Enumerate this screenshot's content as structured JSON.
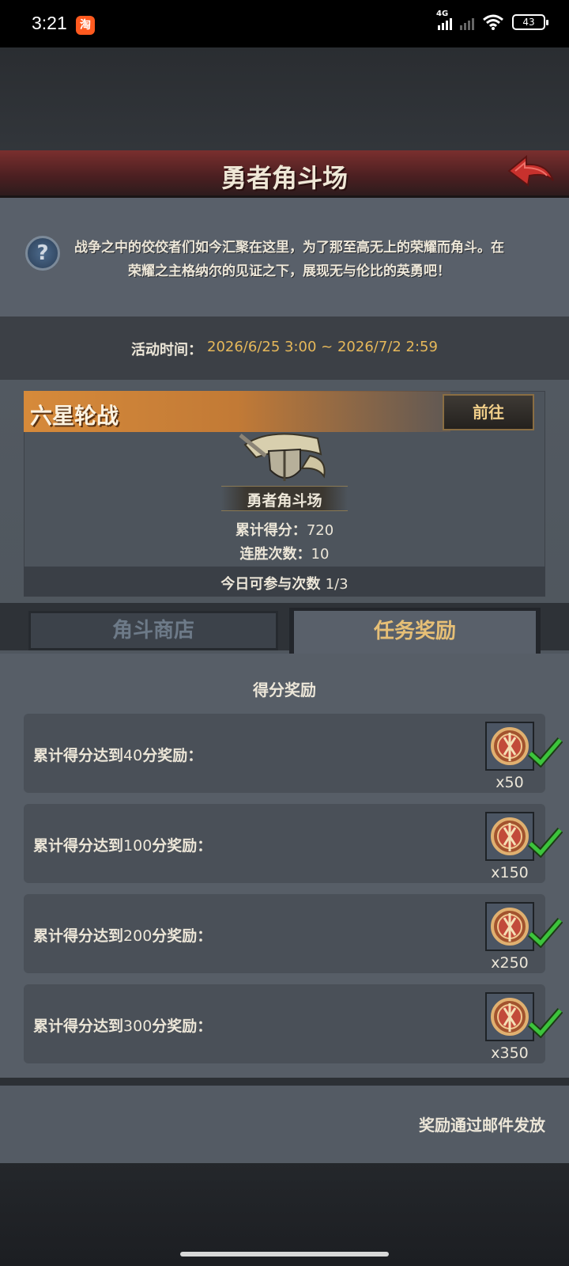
{
  "status_bar": {
    "time": "3:21",
    "app_icon_text": "淘",
    "network": "4G",
    "battery": "43"
  },
  "header": {
    "title": "勇者角斗场",
    "back_icon": "red-back-arrow-icon"
  },
  "intro": {
    "help_icon": "?",
    "text": "战争之中的佼佼者们如今汇聚在这里，为了那至高无上的荣耀而角斗。在荣耀之主格纳尔的见证之下，展现无与伦比的英勇吧！"
  },
  "event_time": {
    "label": "活动时间：",
    "value": "2026/6/25 3:00 ~ 2026/7/2 2:59"
  },
  "event": {
    "name": "六星轮战",
    "go_button": "前往",
    "arena_name": "勇者角斗场",
    "score_label": "累计得分：",
    "score_value": "720",
    "streak_label": "连胜次数：",
    "streak_value": "10",
    "daily_label": "今日可参与次数",
    "daily_value": "1/3"
  },
  "tabs": {
    "shop": "角斗商店",
    "tasks": "任务奖励"
  },
  "tasks": {
    "section_title": "得分奖励",
    "rewards": [
      {
        "prefix": "累计得分达到",
        "score": "40",
        "suffix": "分奖励：",
        "qty": "x50",
        "claimed": true
      },
      {
        "prefix": "累计得分达到",
        "score": "100",
        "suffix": "分奖励：",
        "qty": "x150",
        "claimed": true
      },
      {
        "prefix": "累计得分达到",
        "score": "200",
        "suffix": "分奖励：",
        "qty": "x250",
        "claimed": true
      },
      {
        "prefix": "累计得分达到",
        "score": "300",
        "suffix": "分奖励：",
        "qty": "x350",
        "claimed": true
      }
    ]
  },
  "footer": {
    "note": "奖励通过邮件发放"
  },
  "colors": {
    "accent_gold": "#e6b85a",
    "tab_active": "#e6bf76",
    "check_green": "#3cc43c",
    "banner_red": "#7a2f2e"
  }
}
